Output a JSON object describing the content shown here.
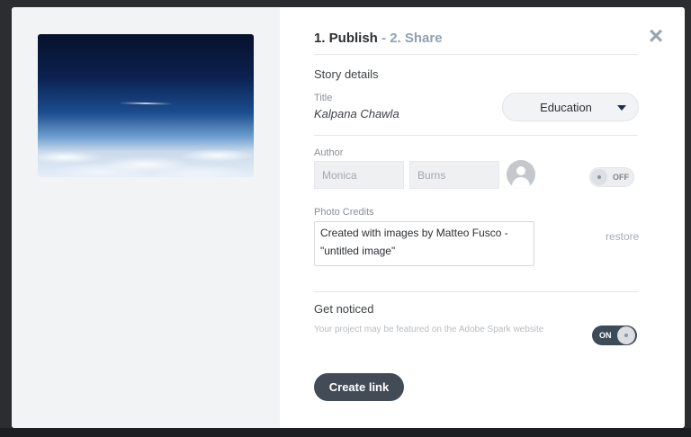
{
  "steps": {
    "step1": "1. Publish",
    "separator": " - ",
    "step2": "2. Share"
  },
  "close_icon": "×",
  "story_details": {
    "heading": "Story details",
    "title_label": "Title",
    "title_value": "Kalpana Chawla",
    "category": "Education"
  },
  "author": {
    "label": "Author",
    "first_name": "Monica",
    "last_name": "Burns",
    "toggle_label": "OFF"
  },
  "photo_credits": {
    "label": "Photo Credits",
    "text": "Created with images by Matteo Fusco - \"untitled image\"",
    "restore_label": "restore"
  },
  "get_noticed": {
    "heading": "Get noticed",
    "description": "Your project may be featured on the Adobe Spark website",
    "toggle_label": "ON"
  },
  "create_button": "Create link",
  "colors": {
    "primary_button": "#434c56",
    "step_inactive": "#8fa1b3",
    "toggle_on": "#3d4a57"
  }
}
